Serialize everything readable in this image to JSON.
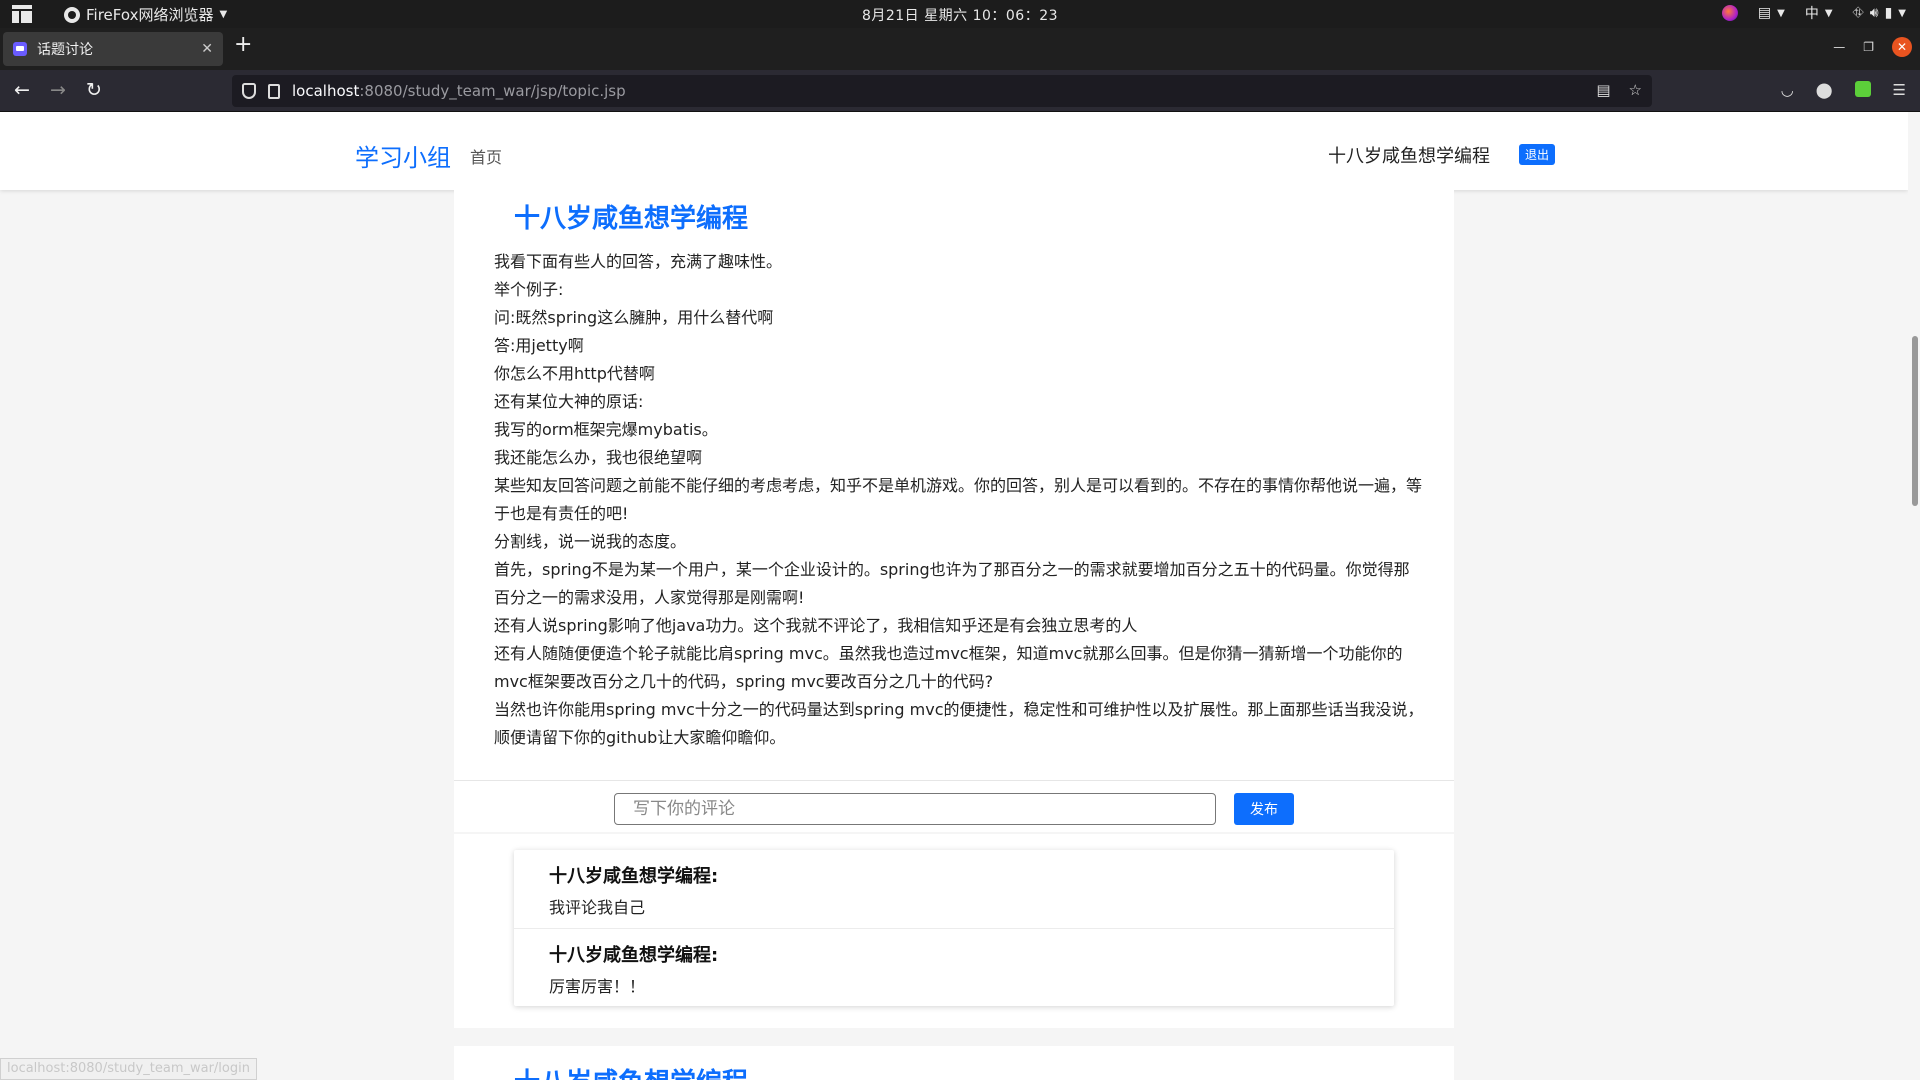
{
  "os_bar": {
    "app_name": "FireFox网络浏览器",
    "clock": "8月21日 星期六  10：06：23",
    "input_method": "中"
  },
  "browser": {
    "tab_title": "话题讨论",
    "url_host": "localhost",
    "url_rest": ":8080/study_team_war/jsp/topic.jsp",
    "status_url": "localhost:8080/study_team_war/login"
  },
  "site_nav": {
    "brand": "学习小组",
    "home": "首页",
    "user_name": "十八岁咸鱼想学编程",
    "logout": "退出"
  },
  "topic": {
    "title": "十八岁咸鱼想学编程",
    "lines": [
      "我看下面有些人的回答，充满了趣味性。",
      "举个例子:",
      "问:既然spring这么臃肿，用什么替代啊",
      "答:用jetty啊",
      "你怎么不用http代替啊",
      "还有某位大神的原话:",
      "我写的orm框架完爆mybatis。",
      "我还能怎么办，我也很绝望啊",
      "某些知友回答问题之前能不能仔细的考虑考虑，知乎不是单机游戏。你的回答，别人是可以看到的。不存在的事情你帮他说一遍，等于也是有责任的吧!",
      "分割线，说一说我的态度。",
      "首先，spring不是为某一个用户，某一个企业设计的。spring也许为了那百分之一的需求就要增加百分之五十的代码量。你觉得那百分之一的需求没用，人家觉得那是刚需啊!",
      "还有人说spring影响了他java功力。这个我就不评论了，我相信知乎还是有会独立思考的人",
      "还有人随随便便造个轮子就能比肩spring mvc。虽然我也造过mvc框架，知道mvc就那么回事。但是你猜一猜新增一个功能你的mvc框架要改百分之几十的代码，spring mvc要改百分之几十的代码?",
      "当然也许你能用spring mvc十分之一的代码量达到spring mvc的便捷性，稳定性和可维护性以及扩展性。那上面那些话当我没说，顺便请留下你的github让大家瞻仰瞻仰。"
    ]
  },
  "comment_form": {
    "placeholder": "写下你的评论",
    "submit": "发布"
  },
  "comments": [
    {
      "author": "十八岁咸鱼想学编程:",
      "text": "我评论我自己"
    },
    {
      "author": "十八岁咸鱼想学编程:",
      "text": "厉害厉害！！"
    }
  ],
  "next_topic": {
    "title": "十八岁咸鱼想学编程"
  }
}
